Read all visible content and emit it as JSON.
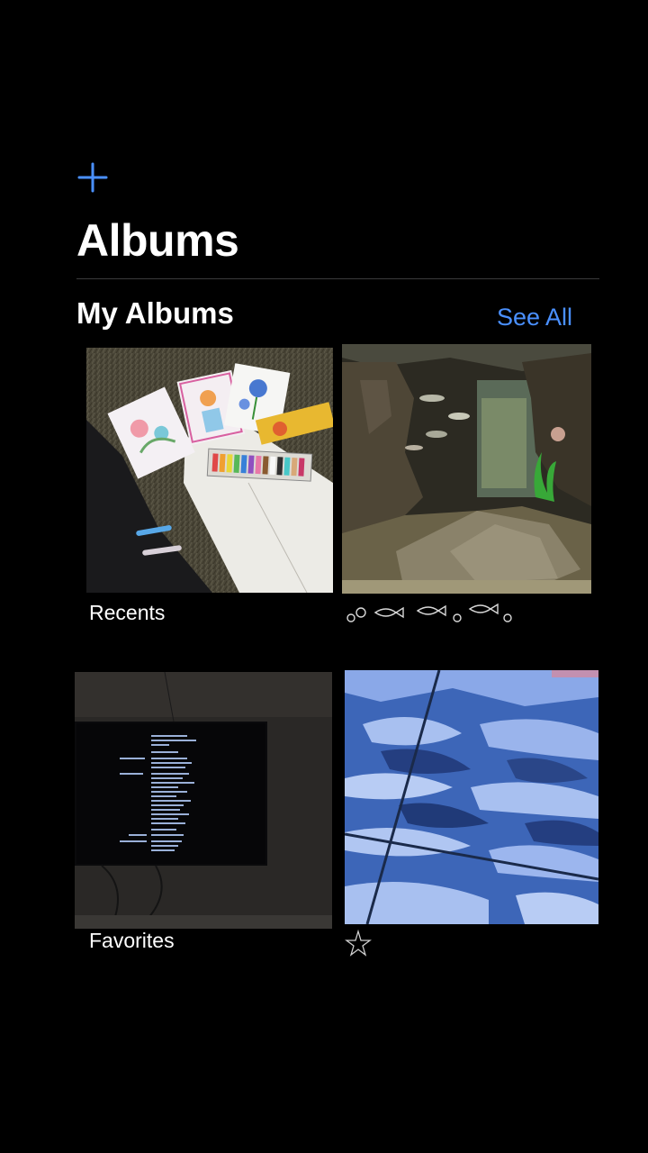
{
  "header": {
    "add_icon": "plus-icon",
    "title": "Albums"
  },
  "section": {
    "title": "My Albums",
    "see_all": "See All"
  },
  "albums": [
    {
      "name": "Recents",
      "thumbnail": "art supplies and drawings on grass"
    },
    {
      "name": "○○ 🐟 🐟 ○ 🐟 ○",
      "thumbnail": "aquarium with fish and rocks"
    },
    {
      "name": "Favorites",
      "thumbnail": "tv screen showing credits in dark room"
    },
    {
      "name": "☆",
      "thumbnail": "blue tiled floor with shadows"
    }
  ],
  "colors": {
    "background": "#000000",
    "accent": "#4a90ff",
    "divider": "#3a3a3c"
  }
}
